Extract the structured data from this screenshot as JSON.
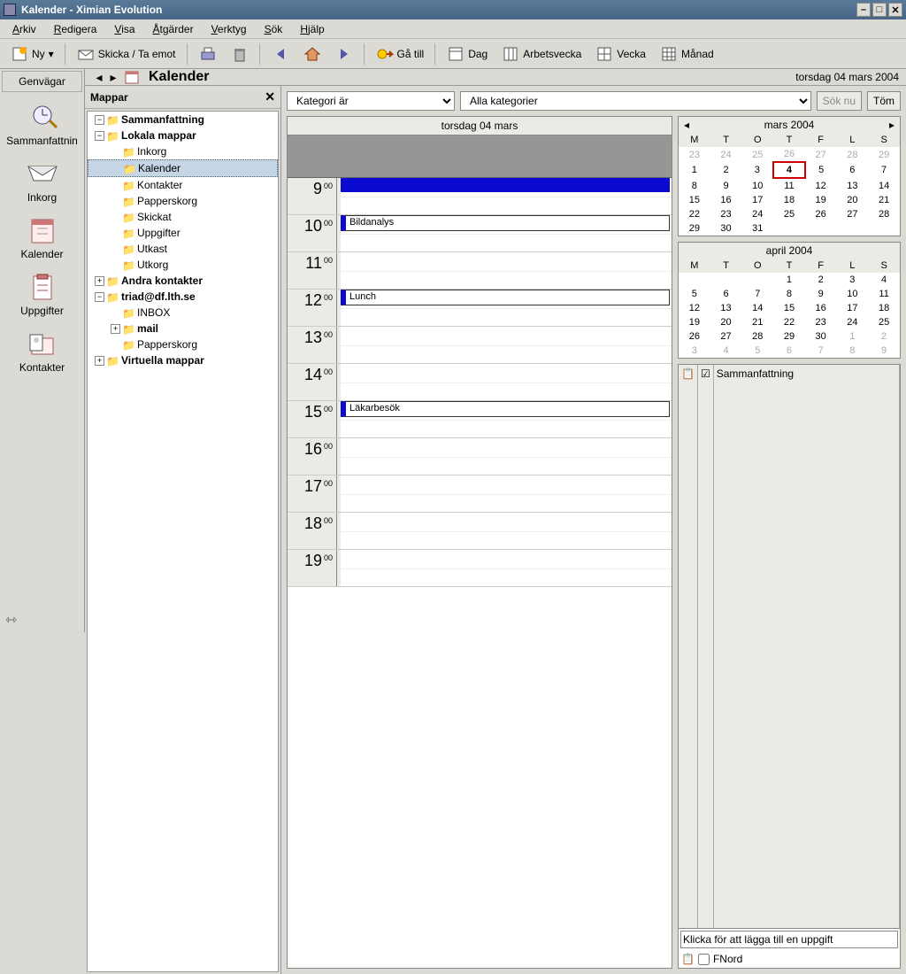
{
  "window": {
    "title": "Kalender - Ximian Evolution"
  },
  "menu": {
    "items": [
      "Arkiv",
      "Redigera",
      "Visa",
      "Åtgärder",
      "Verktyg",
      "Sök",
      "Hjälp"
    ]
  },
  "toolbar": {
    "new": "Ny",
    "send": "Skicka / Ta emot",
    "goto": "Gå till",
    "day": "Dag",
    "workweek": "Arbetsvecka",
    "week": "Vecka",
    "month": "Månad"
  },
  "shortcuts": {
    "header": "Genvägar",
    "items": [
      "Sammanfattnin",
      "Inkorg",
      "Kalender",
      "Uppgifter",
      "Kontakter"
    ]
  },
  "location": {
    "title": "Kalender",
    "date": "torsdag 04 mars 2004"
  },
  "tree": {
    "header": "Mappar",
    "nodes": [
      {
        "d": 0,
        "exp": "-",
        "icon": "home",
        "label": "Sammanfattning",
        "bold": true
      },
      {
        "d": 0,
        "exp": "-",
        "icon": "computer",
        "label": "Lokala mappar",
        "bold": true
      },
      {
        "d": 1,
        "exp": "",
        "icon": "inbox",
        "label": "Inkorg"
      },
      {
        "d": 1,
        "exp": "",
        "icon": "cal",
        "label": "Kalender",
        "sel": true
      },
      {
        "d": 1,
        "exp": "",
        "icon": "contact",
        "label": "Kontakter"
      },
      {
        "d": 1,
        "exp": "",
        "icon": "trash",
        "label": "Papperskorg"
      },
      {
        "d": 1,
        "exp": "",
        "icon": "sent",
        "label": "Skickat"
      },
      {
        "d": 1,
        "exp": "",
        "icon": "task",
        "label": "Uppgifter"
      },
      {
        "d": 1,
        "exp": "",
        "icon": "draft",
        "label": "Utkast"
      },
      {
        "d": 1,
        "exp": "",
        "icon": "out",
        "label": "Utkorg"
      },
      {
        "d": 0,
        "exp": "+",
        "icon": "contact",
        "label": "Andra kontakter",
        "bold": true
      },
      {
        "d": 0,
        "exp": "-",
        "icon": "server",
        "label": "triad@df.lth.se",
        "bold": true
      },
      {
        "d": 1,
        "exp": "",
        "icon": "inbox",
        "label": "INBOX"
      },
      {
        "d": 1,
        "exp": "+",
        "icon": "mail",
        "label": "mail",
        "bold": true
      },
      {
        "d": 1,
        "exp": "",
        "icon": "trash",
        "label": "Papperskorg"
      },
      {
        "d": 0,
        "exp": "+",
        "icon": "virtual",
        "label": "Virtuella mappar",
        "bold": true
      }
    ]
  },
  "filter": {
    "field": "Kategori är",
    "value": "Alla kategorier",
    "search": "Sök nu",
    "clear": "Töm"
  },
  "day": {
    "header": "torsdag 04 mars",
    "hours": [
      "9",
      "10",
      "11",
      "12",
      "13",
      "14",
      "15",
      "16",
      "17",
      "18",
      "19"
    ],
    "minsuffix": "00",
    "events": [
      {
        "hour": "10",
        "label": "Bildanalys"
      },
      {
        "hour": "12",
        "label": "Lunch"
      },
      {
        "hour": "15",
        "label": "Läkarbesök"
      }
    ]
  },
  "mini1": {
    "title": "mars 2004",
    "dow": [
      "M",
      "T",
      "O",
      "T",
      "F",
      "L",
      "S"
    ],
    "rows": [
      [
        {
          "n": 23,
          "dim": 1
        },
        {
          "n": 24,
          "dim": 1
        },
        {
          "n": 25,
          "dim": 1
        },
        {
          "n": 26,
          "dim": 1
        },
        {
          "n": 27,
          "dim": 1
        },
        {
          "n": 28,
          "dim": 1
        },
        {
          "n": 29,
          "dim": 1
        }
      ],
      [
        {
          "n": 1
        },
        {
          "n": 2
        },
        {
          "n": 3
        },
        {
          "n": 4,
          "today": 1,
          "bold": 1
        },
        {
          "n": 5
        },
        {
          "n": 6
        },
        {
          "n": 7
        }
      ],
      [
        {
          "n": 8
        },
        {
          "n": 9
        },
        {
          "n": 10
        },
        {
          "n": 11
        },
        {
          "n": 12
        },
        {
          "n": 13
        },
        {
          "n": 14
        }
      ],
      [
        {
          "n": 15
        },
        {
          "n": 16
        },
        {
          "n": 17
        },
        {
          "n": 18
        },
        {
          "n": 19
        },
        {
          "n": 20
        },
        {
          "n": 21
        }
      ],
      [
        {
          "n": 22
        },
        {
          "n": 23
        },
        {
          "n": 24
        },
        {
          "n": 25
        },
        {
          "n": 26
        },
        {
          "n": 27
        },
        {
          "n": 28
        }
      ],
      [
        {
          "n": 29
        },
        {
          "n": 30
        },
        {
          "n": 31
        },
        {
          "n": "",
          "dim": 1
        },
        {
          "n": "",
          "dim": 1
        },
        {
          "n": "",
          "dim": 1
        },
        {
          "n": "",
          "dim": 1
        }
      ]
    ]
  },
  "mini2": {
    "title": "april 2004",
    "dow": [
      "M",
      "T",
      "O",
      "T",
      "F",
      "L",
      "S"
    ],
    "rows": [
      [
        {
          "n": ""
        },
        {
          "n": ""
        },
        {
          "n": ""
        },
        {
          "n": 1
        },
        {
          "n": 2
        },
        {
          "n": 3
        },
        {
          "n": 4
        }
      ],
      [
        {
          "n": 5
        },
        {
          "n": 6
        },
        {
          "n": 7
        },
        {
          "n": 8
        },
        {
          "n": 9
        },
        {
          "n": 10
        },
        {
          "n": 11
        }
      ],
      [
        {
          "n": 12
        },
        {
          "n": 13
        },
        {
          "n": 14
        },
        {
          "n": 15
        },
        {
          "n": 16
        },
        {
          "n": 17
        },
        {
          "n": 18
        }
      ],
      [
        {
          "n": 19
        },
        {
          "n": 20
        },
        {
          "n": 21
        },
        {
          "n": 22
        },
        {
          "n": 23
        },
        {
          "n": 24
        },
        {
          "n": 25
        }
      ],
      [
        {
          "n": 26
        },
        {
          "n": 27
        },
        {
          "n": 28
        },
        {
          "n": 29
        },
        {
          "n": 30
        },
        {
          "n": 1,
          "dim": 1
        },
        {
          "n": 2,
          "dim": 1
        }
      ],
      [
        {
          "n": 3,
          "dim": 1
        },
        {
          "n": 4,
          "dim": 1
        },
        {
          "n": 5,
          "dim": 1
        },
        {
          "n": 6,
          "dim": 1
        },
        {
          "n": 7,
          "dim": 1
        },
        {
          "n": 8,
          "dim": 1
        },
        {
          "n": 9,
          "dim": 1
        }
      ]
    ]
  },
  "tasks": {
    "header": "Sammanfattning",
    "placeholder": "Klicka för att lägga till en uppgift",
    "items": [
      "FNord"
    ]
  }
}
